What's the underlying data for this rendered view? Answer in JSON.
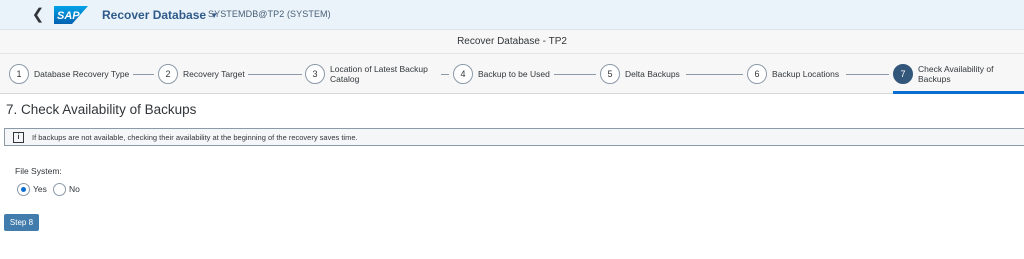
{
  "shell": {
    "back_icon": "chevron-left-icon",
    "logo_text": "SAP",
    "app_title": "Recover Database",
    "system": "SYSTEMDB@TP2 (SYSTEM)"
  },
  "subheader": {
    "title": "Recover Database - TP2"
  },
  "wizard": {
    "steps": [
      {
        "number": "1",
        "label": "Database Recovery Type"
      },
      {
        "number": "2",
        "label": "Recovery Target"
      },
      {
        "number": "3",
        "label": "Location of Latest Backup Catalog"
      },
      {
        "number": "4",
        "label": "Backup to be Used"
      },
      {
        "number": "5",
        "label": "Delta Backups"
      },
      {
        "number": "6",
        "label": "Backup Locations"
      },
      {
        "number": "7",
        "label": "Check Availability of Backups"
      }
    ],
    "active_step": 7
  },
  "content": {
    "heading": "7. Check Availability of Backups",
    "info_icon": "info-icon",
    "info_text": "If backups are not available, checking their availability at the beginning of the recovery saves time.",
    "file_system_label": "File System:",
    "options": [
      {
        "label": "Yes",
        "selected": true
      },
      {
        "label": "No",
        "selected": false
      }
    ],
    "next_button": "Step 8"
  },
  "colors": {
    "accent": "#0a6ed1",
    "active_step": "#33577a",
    "button": "#427cac",
    "shell_bg": "#ebf3fa"
  }
}
